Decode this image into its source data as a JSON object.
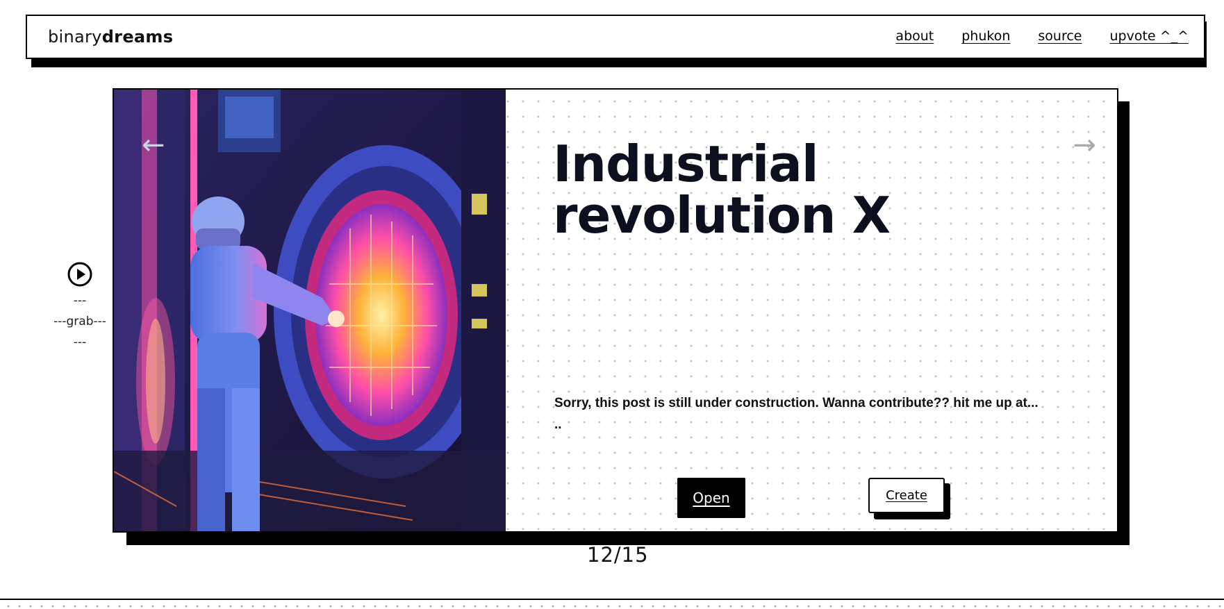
{
  "header": {
    "logo_light": "binary",
    "logo_bold": "dreams",
    "nav": [
      "about",
      "phukon",
      "source",
      "upvote ^_^"
    ]
  },
  "post": {
    "title_line1": "Industrial",
    "title_line2": "revolution X",
    "excerpt_line1": "Sorry, this post is still under construction. Wanna contribute?? hit me up at...",
    "excerpt_line2": "..",
    "open_label": "Open",
    "create_label": "Create",
    "image_icon": "industrial-worker-portal-image"
  },
  "carousel": {
    "counter": "12/15",
    "prev_icon": "arrow-left-icon",
    "next_icon": "arrow-right-icon"
  },
  "grab": {
    "line1": "---",
    "line2": "---grab---",
    "line3": "---",
    "icon": "play-circle-icon"
  },
  "colors": {
    "ink": "#0c0f1d",
    "shadow": "#000000",
    "dot": "#c4c4c4",
    "neon_pink": "#ff3fa4",
    "neon_orange": "#ffb23a",
    "worker_blue": "#5a7de6"
  }
}
